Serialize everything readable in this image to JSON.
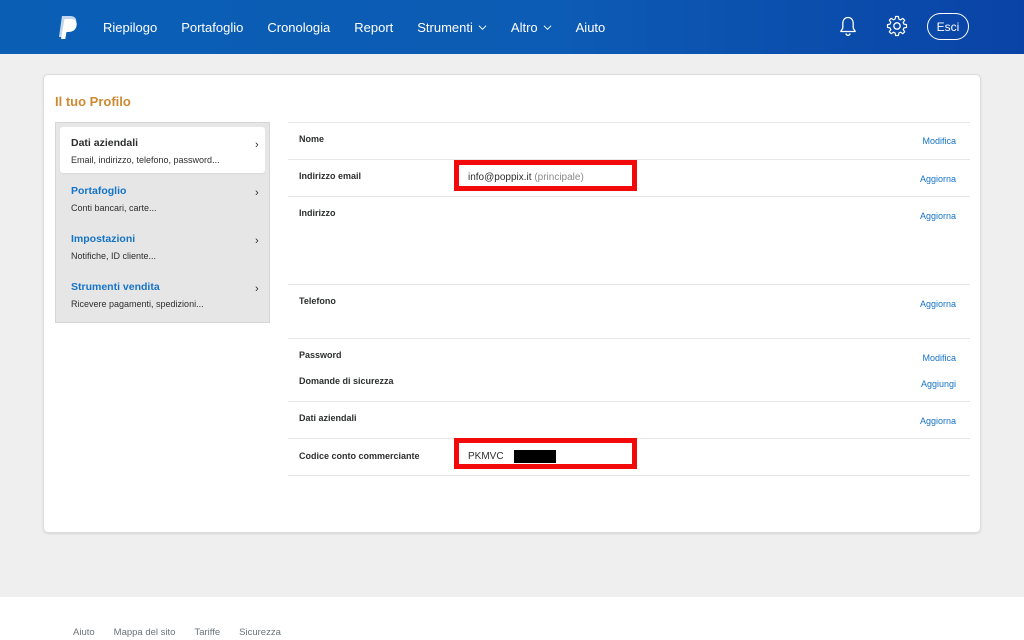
{
  "header": {
    "nav": [
      {
        "label": "Riepilogo",
        "dropdown": false
      },
      {
        "label": "Portafoglio",
        "dropdown": false
      },
      {
        "label": "Cronologia",
        "dropdown": false
      },
      {
        "label": "Report",
        "dropdown": false
      },
      {
        "label": "Strumenti",
        "dropdown": true
      },
      {
        "label": "Altro",
        "dropdown": true
      },
      {
        "label": "Aiuto",
        "dropdown": false
      }
    ],
    "logout_label": "Esci",
    "icons": [
      "paypal-logo",
      "bell-icon",
      "gear-icon"
    ],
    "colors": {
      "bar": "#0c5bb4",
      "text": "#ffffff"
    }
  },
  "profile": {
    "title": "Il tuo Profilo",
    "title_color": "#cd8a33",
    "sidebar": [
      {
        "title": "Dati aziendali",
        "subtitle": "Email, indirizzo, telefono, password...",
        "active": true
      },
      {
        "title": "Portafoglio",
        "subtitle": "Conti bancari, carte...",
        "active": false
      },
      {
        "title": "Impostazioni",
        "subtitle": "Notifiche, ID cliente...",
        "active": false
      },
      {
        "title": "Strumenti vendita",
        "subtitle": "Ricevere pagamenti, spedizioni...",
        "active": false
      }
    ],
    "rows": [
      {
        "label": "Nome",
        "action": "Modifica"
      },
      {
        "label": "Indirizzo email",
        "action": "Aggiorna",
        "value": "info@poppix.it",
        "value_note": "(principale)"
      },
      {
        "label": "Indirizzo",
        "action": "Aggiorna"
      },
      {
        "label": "Telefono",
        "action": "Aggiorna"
      },
      {
        "label": "Password",
        "action": "Modifica"
      },
      {
        "label": "Domande di sicurezza",
        "action": "Aggiungi"
      },
      {
        "label": "Dati aziendali",
        "action": "Aggiorna"
      },
      {
        "label": "Codice conto commerciante",
        "value": "PKMVC"
      }
    ],
    "link_color": "#1573c7",
    "highlight_color": "#f20a0a"
  },
  "footer": {
    "links": [
      "Aiuto",
      "Mappa del sito",
      "Tariffe",
      "Sicurezza"
    ]
  }
}
